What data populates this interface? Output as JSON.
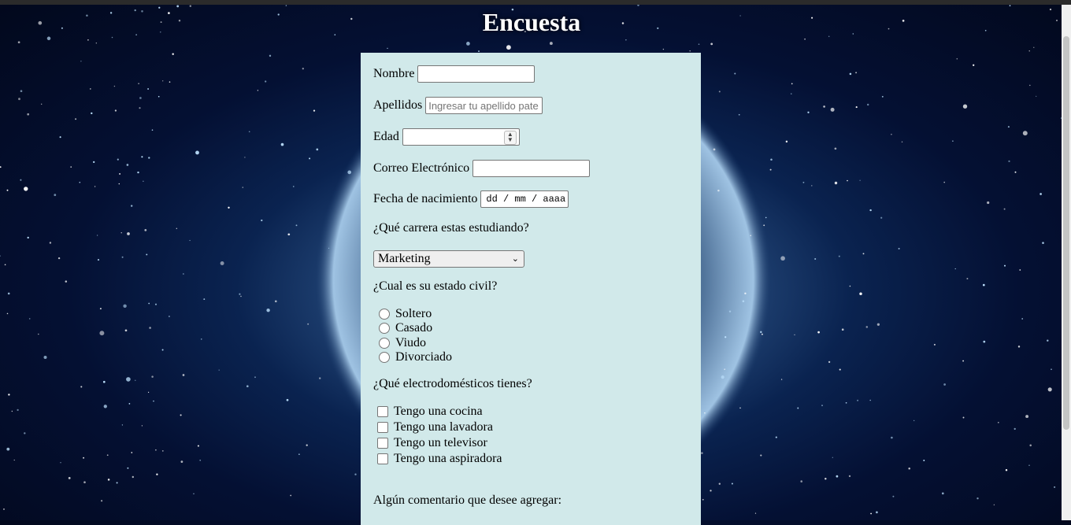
{
  "page": {
    "title": "Encuesta"
  },
  "form": {
    "nombre_label": "Nombre",
    "nombre_value": "",
    "apellidos_label": "Apellidos",
    "apellidos_placeholder": "Ingresar tu apellido pate",
    "edad_label": "Edad",
    "edad_value": "",
    "correo_label": "Correo Electrónico",
    "correo_value": "",
    "fecha_label": "Fecha de nacimiento",
    "fecha_placeholder": "dd / mm / aaaa",
    "carrera_question": "¿Qué carrera estas estudiando?",
    "carrera_selected": "Marketing",
    "estado_question": "¿Cual es su estado civil?",
    "estado_options": [
      "Soltero",
      "Casado",
      "Viudo",
      "Divorciado"
    ],
    "electro_question": "¿Qué electrodomésticos tienes?",
    "electro_options": [
      "Tengo una cocina",
      "Tengo una lavadora",
      "Tengo un televisor",
      "Tengo una aspiradora"
    ],
    "comentario_label": "Algún comentario que desee agregar:"
  },
  "colors": {
    "panel": "#d1e9ea",
    "title": "#ffffff"
  }
}
